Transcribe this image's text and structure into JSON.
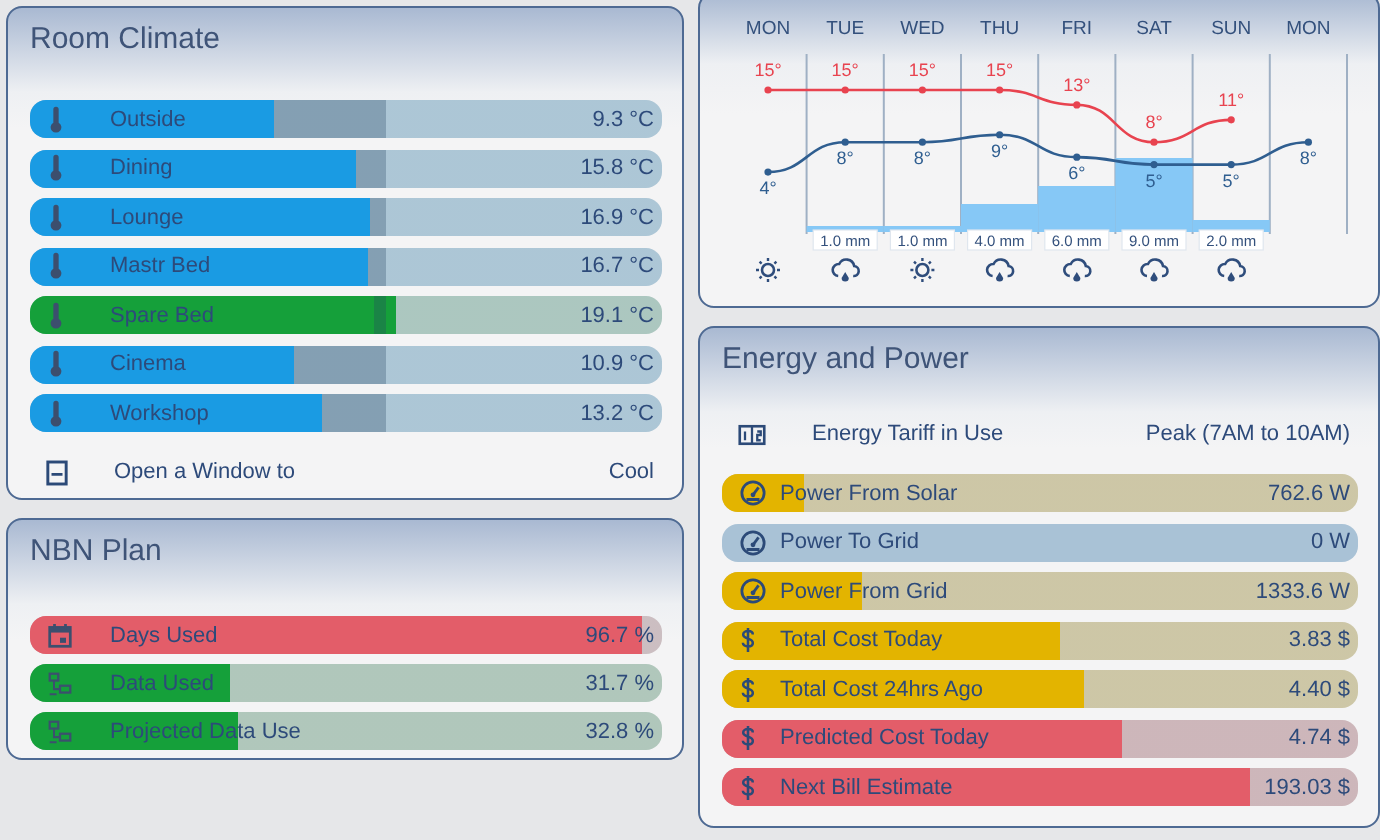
{
  "room_climate": {
    "title": "Room Climate",
    "rows": [
      {
        "label": "Outside",
        "reading": "9.3 °C",
        "level": 0.386,
        "color": "#1a9be3"
      },
      {
        "label": "Dining",
        "reading": "15.8 °C",
        "level": 0.516,
        "color": "#1a9be3"
      },
      {
        "label": "Lounge",
        "reading": "16.9 °C",
        "level": 0.538,
        "color": "#1a9be3"
      },
      {
        "label": "Mastr Bed",
        "reading": "16.7 °C",
        "level": 0.535,
        "color": "#1a9be3"
      },
      {
        "label": "Spare Bed",
        "reading": "19.1 °C",
        "level": 0.58,
        "color": "#15a03a"
      },
      {
        "label": "Cinema",
        "reading": "10.9 °C",
        "level": 0.418,
        "color": "#1a9be3"
      },
      {
        "label": "Workshop",
        "reading": "13.2 °C",
        "level": 0.462,
        "color": "#1a9be3"
      }
    ],
    "status": {
      "label": "Open a Window to",
      "value": "Cool"
    }
  },
  "nbn_plan": {
    "title": "NBN Plan",
    "rows": [
      {
        "label": "Days Used",
        "reading": "96.7 %",
        "level": 0.967,
        "color": "#e35d69",
        "kind": "calendar"
      },
      {
        "label": "Data Used",
        "reading": "31.7 %",
        "level": 0.317,
        "color": "#15a03a",
        "kind": "network"
      },
      {
        "label": "Projected Data Use",
        "reading": "32.8 %",
        "level": 0.328,
        "color": "#15a03a",
        "kind": "network"
      }
    ]
  },
  "weather": {
    "chart_data": {
      "type": "line",
      "categories": [
        "MON",
        "TUE",
        "WED",
        "THU",
        "FRI",
        "SAT",
        "SUN",
        "MON"
      ],
      "series": [
        {
          "color": "#e8434f",
          "marker": true,
          "values": [
            15,
            15,
            15,
            15,
            13,
            8,
            11,
            null
          ],
          "value_labels": [
            "15°",
            "15°",
            "15°",
            "15°",
            "13°",
            "8°",
            "11°",
            null
          ]
        },
        {
          "color": "#2f5e90",
          "marker": true,
          "values": [
            4,
            8,
            8,
            9,
            6,
            5,
            5,
            8
          ],
          "value_labels": [
            "4°",
            "8°",
            "8°",
            "9°",
            "6°",
            "5°",
            "5°",
            "8°"
          ]
        }
      ]
    },
    "rain": [
      {
        "label": "1.0 mm"
      },
      {
        "label": "1.0 mm"
      },
      {
        "label": "4.0 mm"
      },
      {
        "label": "6.0 mm"
      },
      {
        "label": "9.0 mm"
      },
      {
        "label": "2.0 mm"
      }
    ],
    "icons": [
      {
        "kind": "sun"
      },
      {
        "kind": "rain"
      },
      {
        "kind": "sun"
      },
      {
        "kind": "rain"
      },
      {
        "kind": "rain"
      },
      {
        "kind": "rain"
      },
      {
        "kind": "rain"
      }
    ]
  },
  "energy": {
    "title": "Energy and Power",
    "tariff": {
      "label": "Energy Tariff in Use",
      "value": "Peak (7AM to 10AM)"
    },
    "rows": [
      {
        "label": "Power From Solar",
        "reading": "762.6 W",
        "level": 0.13,
        "color": "#e3b400",
        "kind": "gauge"
      },
      {
        "label": "Power To Grid",
        "reading": "0 W",
        "level": 0,
        "color": "#a9c2d6",
        "kind": "gauge"
      },
      {
        "label": "Power From Grid",
        "reading": "1333.6 W",
        "level": 0.22,
        "color": "#e3b400",
        "kind": "gauge"
      },
      {
        "label": "Total Cost Today",
        "reading": "3.83 $",
        "level": 0.53,
        "color": "#e3b400",
        "kind": "dollar"
      },
      {
        "label": "Total Cost 24hrs Ago",
        "reading": "4.40 $",
        "level": 0.57,
        "color": "#e3b400",
        "kind": "dollar"
      },
      {
        "label": "Predicted Cost Today",
        "reading": "4.74 $",
        "level": 0.63,
        "color": "#e35d69",
        "kind": "dollar"
      },
      {
        "label": "Next Bill Estimate",
        "reading": "193.03 $",
        "level": 0.83,
        "color": "#e35d69",
        "kind": "dollar"
      }
    ]
  }
}
